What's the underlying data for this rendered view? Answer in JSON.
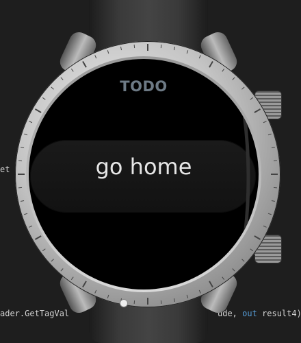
{
  "code": {
    "left_fragment": "et",
    "bottom_left": "ader.GetTagVal",
    "bottom_right_pre": "ude, ",
    "bottom_right_kw": "out",
    "bottom_right_post": " result4)"
  },
  "watch": {
    "title": "TODO",
    "item_label": "go home"
  },
  "colors": {
    "background": "#1e1e1e",
    "title": "#6d7a85",
    "item_text": "#e6e6e6",
    "keyword": "#569cd6"
  }
}
